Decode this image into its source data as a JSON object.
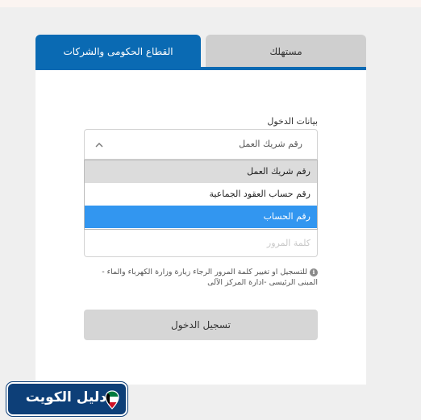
{
  "tabs": [
    {
      "label": "القطاع الحكومى والشركات",
      "active": true
    },
    {
      "label": "مستهلك",
      "active": false
    }
  ],
  "login": {
    "field_label": "بيانات الدخول",
    "select": {
      "value": "رقم شريك العمل",
      "options": [
        {
          "label": "رقم شريك العمل",
          "state": "hover"
        },
        {
          "label": "رقم حساب العقود الجماعية",
          "state": "normal"
        },
        {
          "label": "رقم الحساب",
          "state": "selected"
        }
      ]
    },
    "password_placeholder": "كلمة المرور",
    "info_text": "للتسجيل او تغيير كلمة المرور الرجاء زيارة وزارة الكهرباء والماء - المبنى الرئيسى -ادارة المركز الآلى",
    "submit_label": "تسجيل الدخول"
  },
  "brand": {
    "text": "دليل الكويت",
    "pin_icon": "kuwait-flag-pin-icon"
  },
  "colors": {
    "primary_blue": "#0a6ab3",
    "selected_option": "#3296f0",
    "brand_navy": "#0d3f78",
    "flag_green": "#007a3d",
    "flag_red": "#ce1126",
    "flag_black": "#000000"
  }
}
